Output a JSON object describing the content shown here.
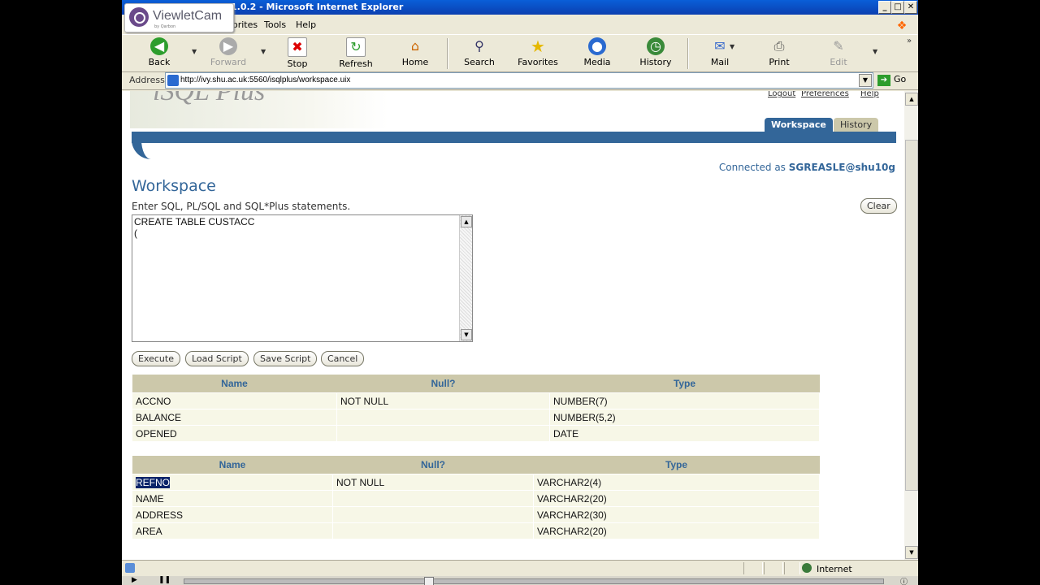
{
  "window": {
    "title": "1.0.2 - Microsoft Internet Explorer",
    "ctrl_min": "_",
    "ctrl_max": "□",
    "ctrl_close": "✕"
  },
  "logo": {
    "brand": "ViewletCam",
    "by": "by Qarbon"
  },
  "menu": {
    "items": [
      "orites",
      "Tools",
      "Help"
    ]
  },
  "toolbar": {
    "back": "Back",
    "forward": "Forward",
    "stop": "Stop",
    "refresh": "Refresh",
    "home": "Home",
    "search": "Search",
    "favorites": "Favorites",
    "media": "Media",
    "history": "History",
    "mail": "Mail",
    "print": "Print",
    "edit": "Edit"
  },
  "address": {
    "label": "Address",
    "url": "http://ivy.shu.ac.uk:5560/isqlplus/workspace.uix",
    "go": "Go"
  },
  "page": {
    "logo_text": "iSQL Plus",
    "top_links": [
      "Logout",
      "Preferences",
      "Help"
    ],
    "tabs": {
      "workspace": "Workspace",
      "history": "History"
    },
    "connected_label": "Connected as",
    "connected_user": "SGREASLE@shu10g",
    "title": "Workspace",
    "instructions": "Enter SQL, PL/SQL and SQL*Plus statements.",
    "clear": "Clear",
    "editor_text": "CREATE TABLE CUSTACC\n(",
    "buttons": {
      "execute": "Execute",
      "load": "Load Script",
      "save": "Save Script",
      "cancel": "Cancel"
    }
  },
  "tables": [
    {
      "headers": [
        "Name",
        "Null?",
        "Type"
      ],
      "rows": [
        [
          "ACCNO",
          "NOT NULL",
          "NUMBER(7)"
        ],
        [
          "BALANCE",
          "",
          "NUMBER(5,2)"
        ],
        [
          "OPENED",
          "",
          "DATE"
        ]
      ]
    },
    {
      "headers": [
        "Name",
        "Null?",
        "Type"
      ],
      "rows": [
        [
          "REFNO",
          "NOT NULL",
          "VARCHAR2(4)"
        ],
        [
          "NAME",
          "",
          "VARCHAR2(20)"
        ],
        [
          "ADDRESS",
          "",
          "VARCHAR2(30)"
        ],
        [
          "AREA",
          "",
          "VARCHAR2(20)"
        ]
      ]
    }
  ],
  "status": {
    "zone": "Internet"
  }
}
